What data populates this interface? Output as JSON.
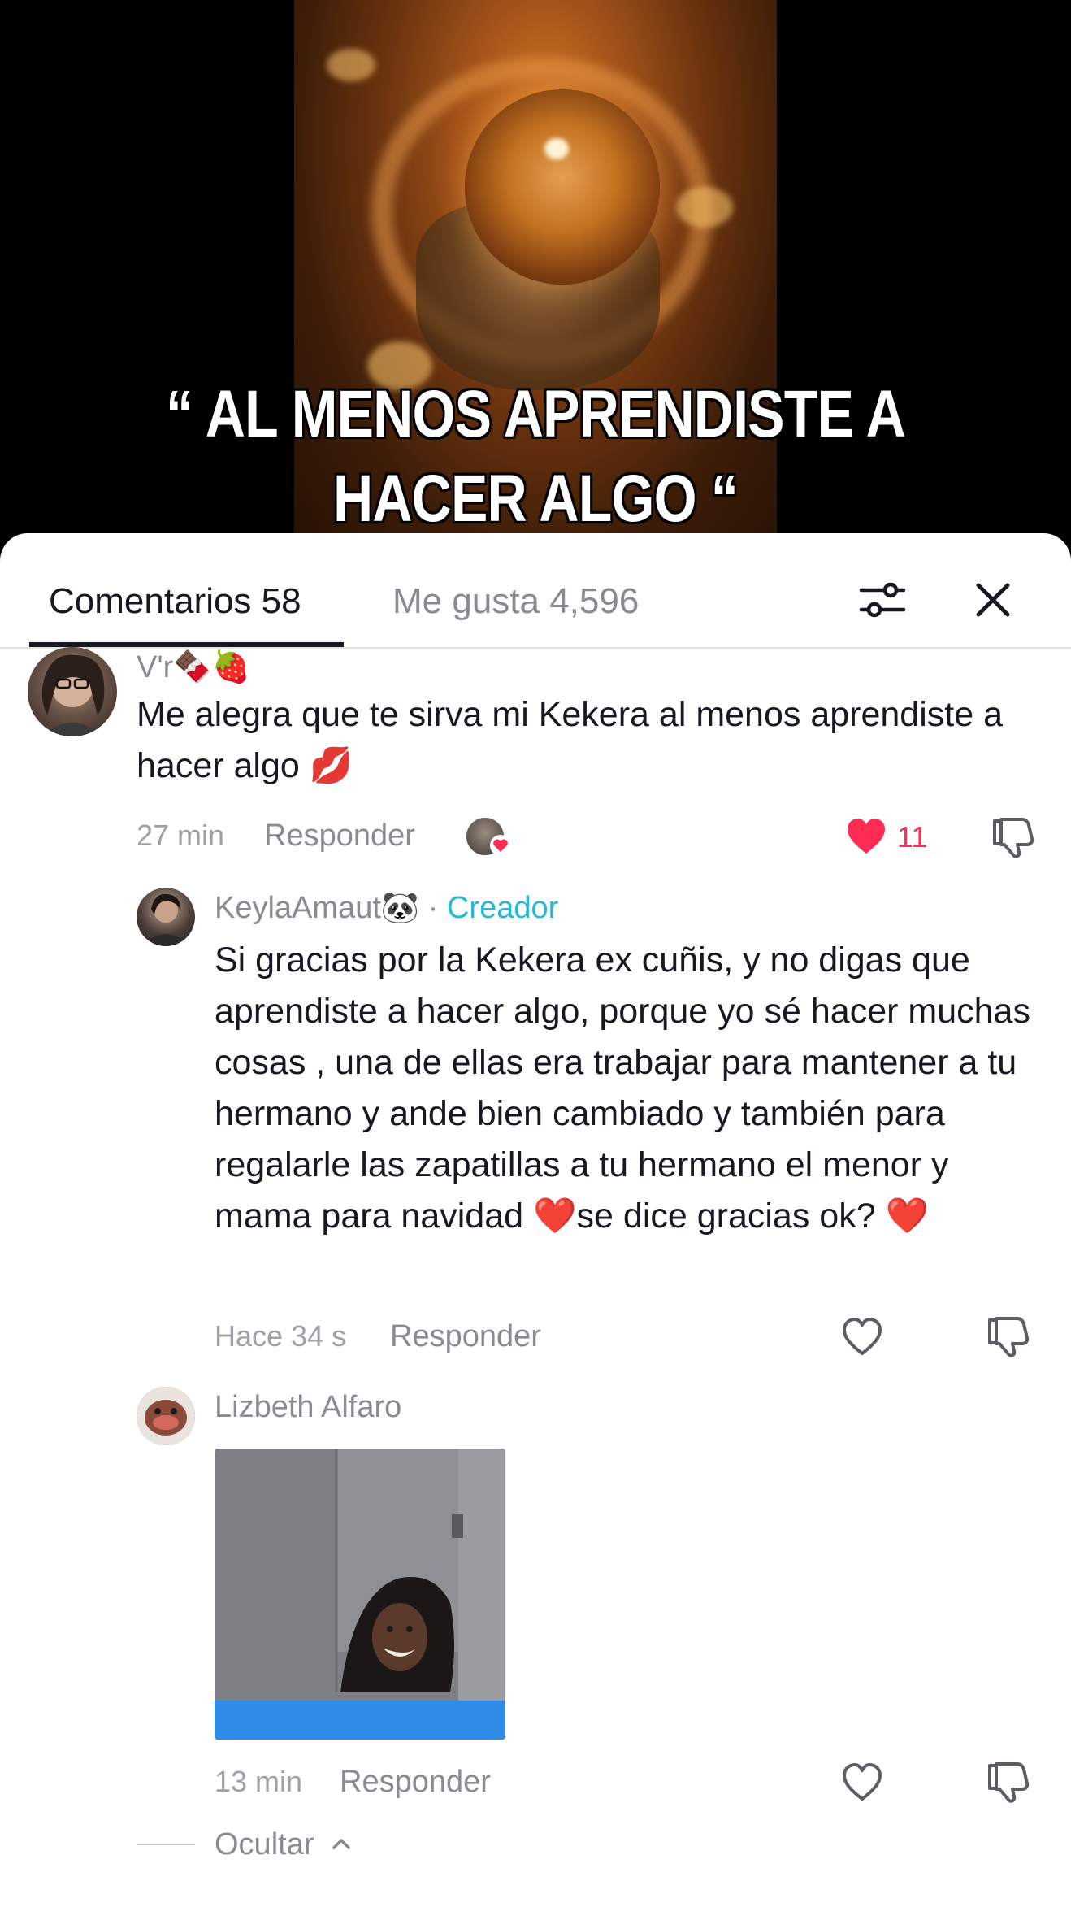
{
  "video": {
    "caption": "“ AL MENOS APRENDISTE A HACER ALGO “"
  },
  "tabs": {
    "comments_label": "Comentarios 58",
    "likes_label": "Me gusta 4,596",
    "filter_icon": "filter-sliders-icon",
    "close_icon": "close-icon"
  },
  "comments": [
    {
      "name": "V'r🍫🍓",
      "text": "Me alegra que te sirva mi Kekera al menos aprendiste a hacer algo 💋",
      "time": "27 min",
      "reply_label": "Responder",
      "likes": "11",
      "liked": true,
      "liked_by_creator": true
    },
    {
      "name": "KeylaAmaut🐼",
      "separator": " · ",
      "badge": "Creador",
      "text": "Si gracias por la Kekera ex cuñis, y no digas que aprendiste a hacer algo, porque yo sé hacer muchas cosas , una de ellas era trabajar para mantener a tu hermano y ande bien cambiado y también para regalarle las zapatillas a tu hermano el menor y mama para navidad ❤️se dice gracias ok? ❤️",
      "time": "Hace 34 s",
      "reply_label": "Responder"
    },
    {
      "name": "Lizbeth Alfaro",
      "time": "13 min",
      "reply_label": "Responder"
    }
  ],
  "hide_label": "Ocultar",
  "colors": {
    "accent_like": "#fe2c55",
    "creator_badge": "#26b8d4",
    "text_primary": "#161823",
    "text_secondary": "#8a8b91"
  }
}
